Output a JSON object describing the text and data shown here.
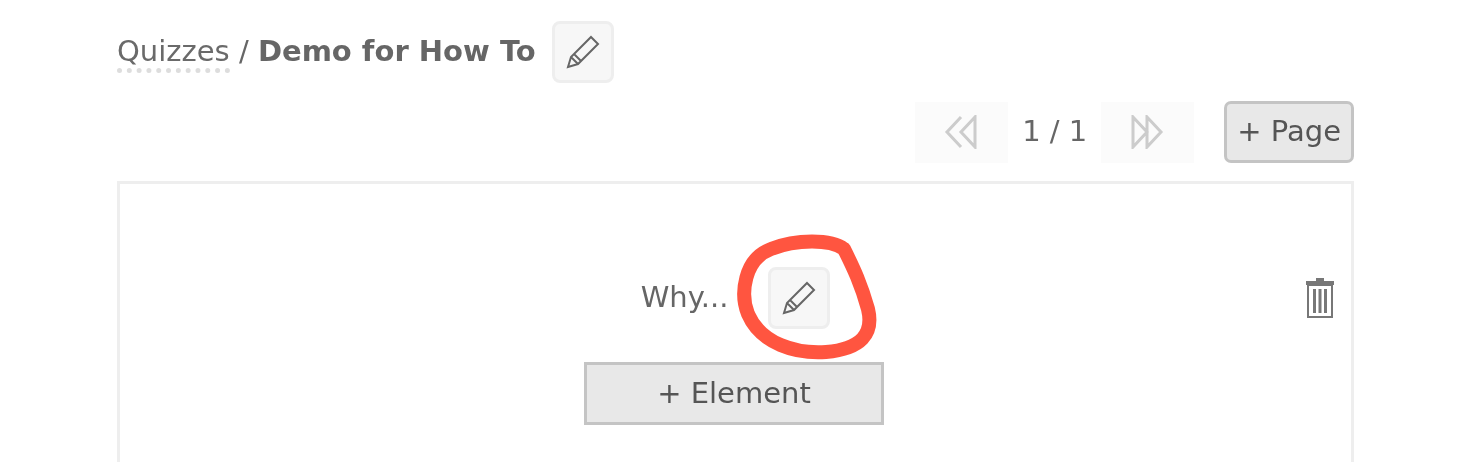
{
  "breadcrumb": {
    "parent": "Quizzes",
    "separator": "/",
    "current": "Demo for How To"
  },
  "pager": {
    "previous": {
      "disabled": true
    },
    "reading": "1 / 1",
    "next": {
      "disabled": true
    }
  },
  "add_page_button": "+ Page",
  "question": {
    "text": "Why..."
  },
  "add_element_button": "+ Element"
}
